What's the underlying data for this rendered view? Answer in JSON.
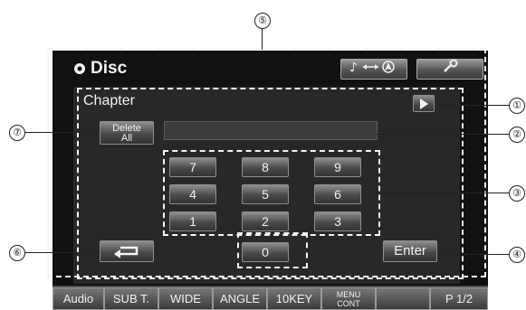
{
  "header": {
    "title": "Disc",
    "source_icon": "disc-icon",
    "audio_nav_icon": "music-swap-nav-icon",
    "setup_icon": "wrench-icon"
  },
  "panel": {
    "title": "Chapter",
    "delete_all_label_line1": "Delete",
    "delete_all_label_line2": "All",
    "input_value": "",
    "keypad": [
      "7",
      "8",
      "9",
      "4",
      "5",
      "6",
      "1",
      "2",
      "3",
      "0"
    ],
    "enter_label": "Enter",
    "back_icon": "return-arrow-icon",
    "play_icon": "play-icon"
  },
  "bottom_tabs": [
    {
      "label": "Audio"
    },
    {
      "label": "SUB T."
    },
    {
      "label": "WIDE"
    },
    {
      "label": "ANGLE"
    },
    {
      "label": "10KEY"
    },
    {
      "label_line1": "MENU",
      "label_line2": "CONT"
    },
    {
      "label": ""
    },
    {
      "label": "P 1/2"
    }
  ],
  "callouts": [
    "⑤",
    "①",
    "②",
    "③",
    "④",
    "⑥",
    "⑦"
  ]
}
